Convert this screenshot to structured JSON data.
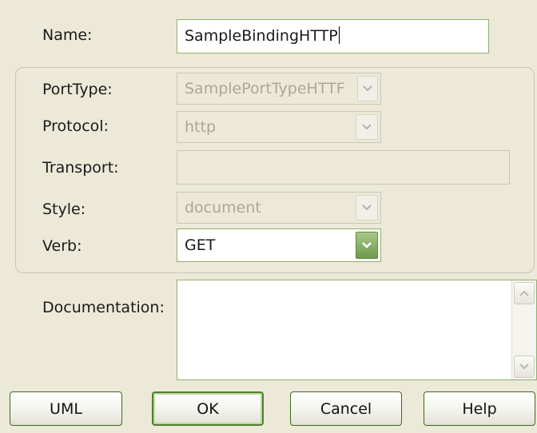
{
  "form": {
    "name_label": "Name:",
    "name_value": "SampleBindingHTTP",
    "port_type_label": "PortType:",
    "port_type_value": "SamplePortTypeHTTF",
    "protocol_label": "Protocol:",
    "protocol_value": "http",
    "transport_label": "Transport:",
    "transport_value": "",
    "style_label": "Style:",
    "style_value": "document",
    "verb_label": "Verb:",
    "verb_value": "GET",
    "documentation_label": "Documentation:",
    "documentation_value": ""
  },
  "buttons": {
    "uml": "UML",
    "ok": "OK",
    "cancel": "Cancel",
    "help": "Help"
  },
  "colors": {
    "dialog_bg": "#ECE9D8",
    "accent_green": "#6F9A4D",
    "field_border": "#8FAF6E"
  }
}
